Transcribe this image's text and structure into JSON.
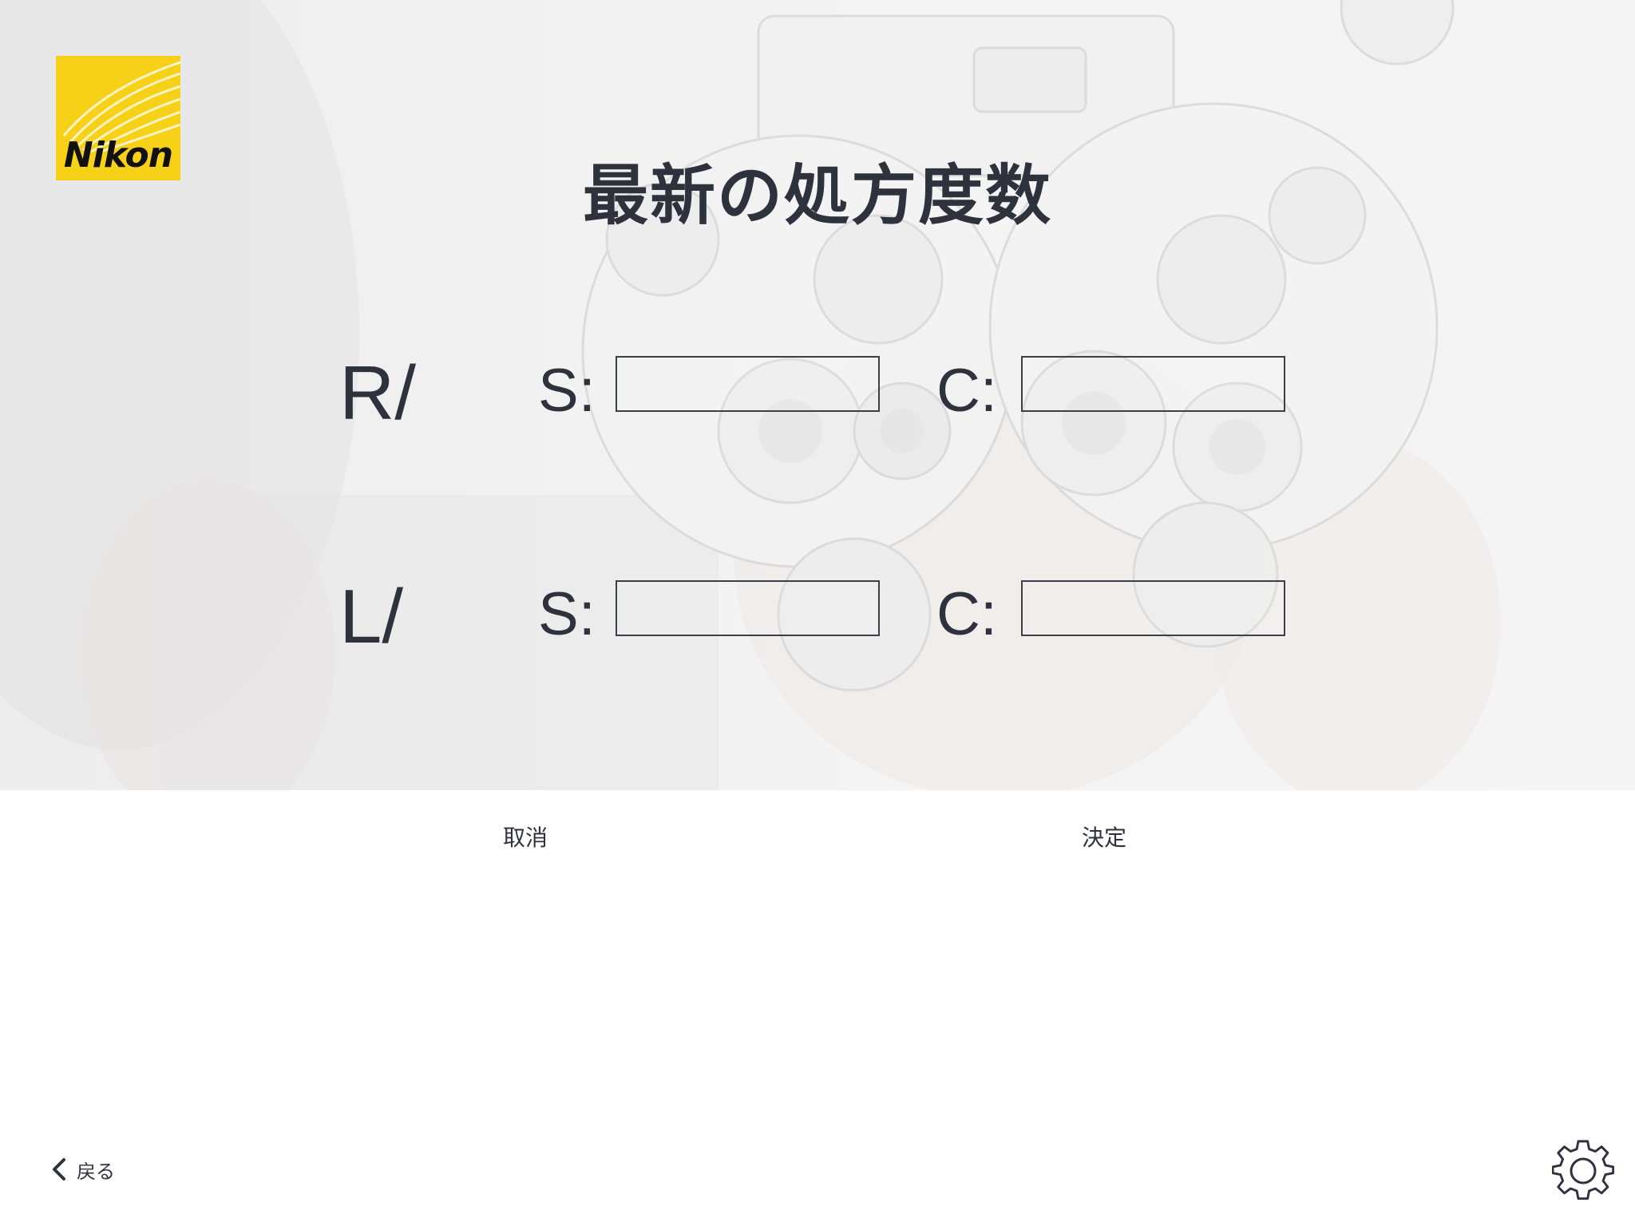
{
  "brand": {
    "logo_text": "Nikon"
  },
  "page": {
    "title": "最新の処方度数"
  },
  "form": {
    "right": {
      "label": "R/",
      "sphere_label": "S:",
      "sphere_value": "",
      "cylinder_label": "C:",
      "cylinder_value": ""
    },
    "left": {
      "label": "L/",
      "sphere_label": "S:",
      "sphere_value": "",
      "cylinder_label": "C:",
      "cylinder_value": ""
    }
  },
  "actions": {
    "cancel_label": "取消",
    "confirm_label": "決定"
  },
  "footer": {
    "back_label": "戻る",
    "settings_icon": "gear-icon",
    "back_icon": "chevron-left-icon"
  },
  "colors": {
    "text": "#2d323c",
    "logo_yellow": "#f7d117",
    "input_border": "#3a3f48"
  }
}
